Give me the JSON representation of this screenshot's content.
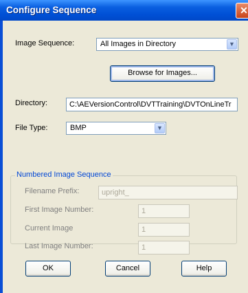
{
  "window": {
    "title": "Configure Sequence",
    "close_glyph": "✕"
  },
  "image_sequence": {
    "label": "Image Sequence:",
    "value": "All Images in Directory"
  },
  "browse_button": {
    "label": "Browse for Images..."
  },
  "directory": {
    "label": "Directory:",
    "value": "C:\\AEVersionControl\\DVTTraining\\DVTOnLineTr"
  },
  "file_type": {
    "label": "File Type:",
    "value": "BMP"
  },
  "numbered_group": {
    "title": "Numbered Image Sequence",
    "filename_prefix": {
      "label": "Filename Prefix:",
      "value": "upright_"
    },
    "first_image_number": {
      "label": "First Image Number:",
      "value": "1"
    },
    "current_image": {
      "label": "Current Image",
      "value": "1"
    },
    "last_image_number": {
      "label": "Last Image Number:",
      "value": "1"
    }
  },
  "buttons": {
    "ok": "OK",
    "cancel": "Cancel",
    "help": "Help"
  },
  "icons": {
    "dropdown": "chevron-down-icon",
    "close": "close-icon"
  },
  "colors": {
    "title_bar": "#0050D6",
    "dialog_bg": "#ECE9D8",
    "group_title": "#0046D5"
  }
}
